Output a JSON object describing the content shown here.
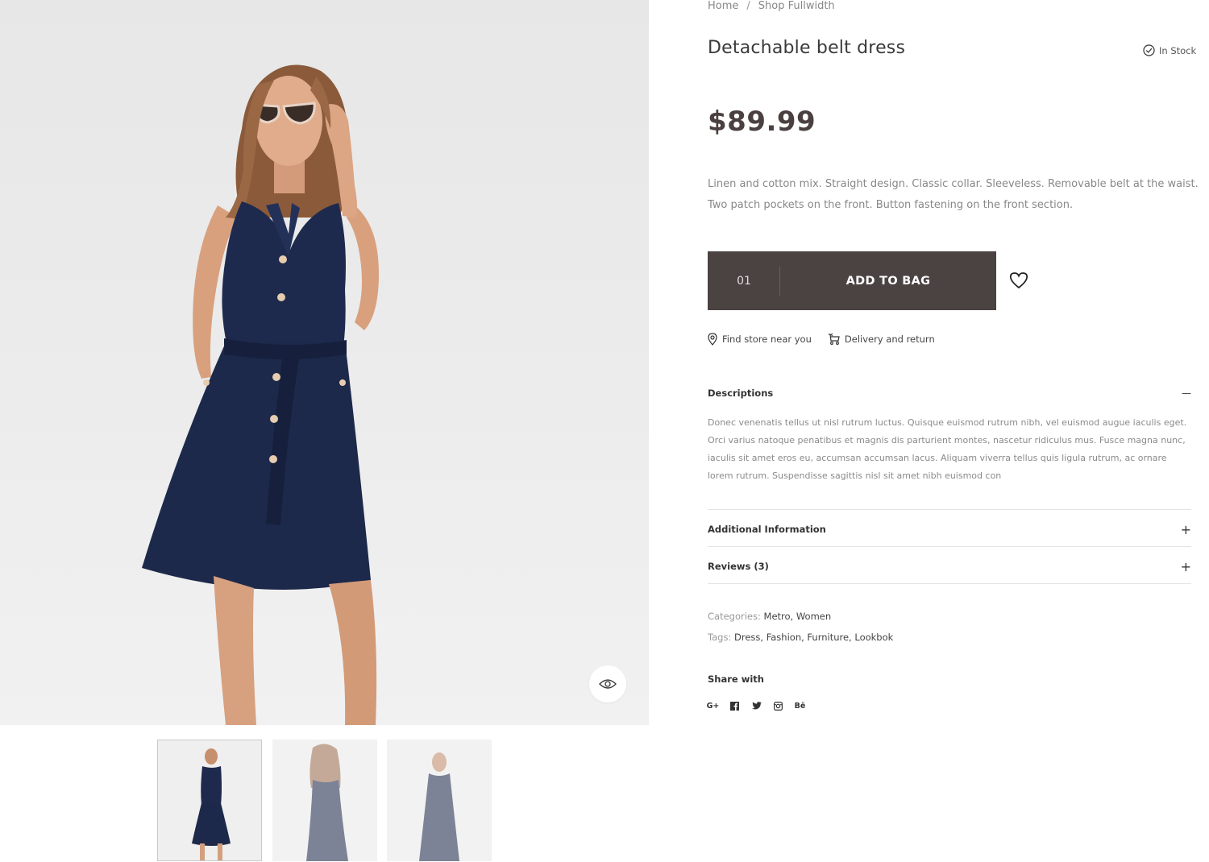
{
  "breadcrumb": {
    "home": "Home",
    "separator": "/",
    "current": "Shop Fullwidth"
  },
  "product": {
    "title": "Detachable belt dress",
    "stock": "In Stock",
    "price": "$89.99",
    "summary": "Linen and cotton mix. Straight design. Classic collar. Sleeveless. Removable belt at the waist. Two patch pockets on the front. Button fastening on the front section."
  },
  "cart": {
    "quantity": "01",
    "add_label": "ADD TO BAG"
  },
  "links": {
    "store": "Find store near you",
    "delivery": "Delivery and return"
  },
  "accordion": {
    "descriptions": {
      "title": "Descriptions",
      "toggle": "—",
      "body": "Donec venenatis tellus ut nisl rutrum luctus. Quisque euismod rutrum nibh, vel euismod augue iaculis eget. Orci varius natoque penatibus et magnis dis parturient montes, nascetur ridiculus mus. Fusce magna nunc, iaculis sit amet eros eu, accumsan accumsan lacus. Aliquam viverra tellus quis ligula rutrum, ac ornare lorem rutrum. Suspendisse sagittis nisl sit amet nibh euismod con"
    },
    "additional": {
      "title": "Additional Information",
      "toggle": "+"
    },
    "reviews": {
      "title": "Reviews (3)",
      "toggle": "+"
    }
  },
  "meta": {
    "categories_label": "Categories:",
    "categories": "Metro, Women",
    "tags_label": "Tags:",
    "tags": "Dress, Fashion, Furniture, Lookbok"
  },
  "share": {
    "title": "Share with",
    "networks": [
      "G+",
      "f",
      "t",
      "ig",
      "Bë"
    ]
  },
  "gallery": {
    "thumbnails": [
      "front",
      "back",
      "front-casual"
    ],
    "active": 0
  },
  "colors": {
    "button_bg": "#4b4242",
    "price": "#4a4040",
    "dress": "#1e2a4d"
  }
}
